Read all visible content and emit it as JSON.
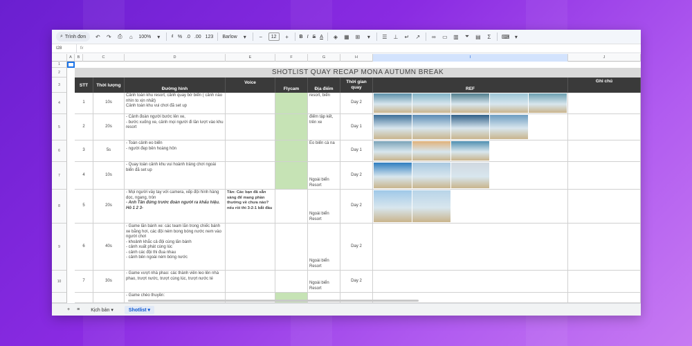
{
  "toolbar": {
    "search_label": "Trình đơn",
    "zoom": "100%",
    "currency": "₫",
    "percent": "%",
    "dec_less": ".0",
    "dec_more": ".00",
    "num_format": "123",
    "font": "Barlow",
    "font_size": "12",
    "bold": "B",
    "italic": "I",
    "strike": "S",
    "text_color": "A"
  },
  "formula": {
    "namebox": "I28",
    "fx": "fx"
  },
  "columns": [
    "A",
    "B",
    "C",
    "D",
    "E",
    "F",
    "G",
    "H",
    "I",
    "J"
  ],
  "rows": [
    "1",
    "2",
    "3",
    "4",
    "5",
    "6",
    "7",
    "8",
    "9",
    "10"
  ],
  "sheet_title": "SHOTLIST QUAY RECAP MONA AUTUMN BREAK",
  "headers": {
    "stt": "STT",
    "duration": "Thời lượng",
    "shot": "Đường hình",
    "voice": "Voice",
    "flycam": "Flycam",
    "location": "Địa điểm",
    "time": "Thời gian quay",
    "ref": "REF",
    "note": "Ghi chú"
  },
  "data_rows": [
    {
      "stt": "1",
      "duration": "10s",
      "shot": "Cảnh toàn khu resort, cảnh quay bờ biển ( cảnh nào nhìn to xịn nhất)\nCảnh toàn khu vui chơi đã set up",
      "voice": "",
      "location": "resort, biển",
      "time": "Day 2"
    },
    {
      "stt": "2",
      "duration": "20s",
      "shot": "- Cảnh đoàn người bước lên xe,\n- bước xuống xe, cảnh mọi người đi lần lượt vào khu resort",
      "voice": "",
      "location": "điểm tập kết, trên xe",
      "time": "Day 1"
    },
    {
      "stt": "3",
      "duration": "5s",
      "shot": "- Toàn cảnh eo biển\n- người đẹp bên hoàng hôn",
      "voice": "",
      "location": "Eo biển cà na",
      "time": "Day 1"
    },
    {
      "stt": "4",
      "duration": "10s",
      "shot": "- Quay toàn cảnh khu vui hoành tráng chơi ngoài biển đã set up",
      "voice": "",
      "location": "Ngoài biển Resort",
      "time": "Day 2"
    },
    {
      "stt": "5",
      "duration": "20s",
      "shot": "- Mọi người vẫy tay với camera, xếp đội hình hàng dọc, ngang, tròn",
      "shot_bold": "- Anh Tân đứng trước đoàn người ra khẩu hiệu. Hô 1 2 3-",
      "voice": "Tân: Các bạn đã sẵn sàng để mang phần thưởng về chưa nào? nếu rồi thì 3-2-1 bắt đầu",
      "location": "Ngoài biển Resort",
      "time": "Day 2"
    },
    {
      "stt": "6",
      "duration": "40s",
      "shot": "- Game lăn bánh xe: các team lăn trong chiếc bánh xe bằng hơi, các đội ném bong bóng nước nem vào người chơi\n- khoảnh khắc cả đội cùng lăn bánh\n- cảnh xuất phát cùng lúc\n- cảnh các đội thi đua nhau\n- cảnh bên ngoài ném bóng nước",
      "voice": "",
      "location": "Ngoài biển Resort",
      "time": "Day 2"
    },
    {
      "stt": "7",
      "duration": "30s",
      "shot": "- Game vượt nhà phao: các thành viên leo lên nhà phao, trượt nước, trượt cùng lúc, trượt nước té",
      "voice": "",
      "location": "Ngoài biển Resort",
      "time": "Day 2"
    },
    {
      "stt": "",
      "duration": "",
      "shot": "- Game chèo thuyền:",
      "voice": "",
      "location": "",
      "time": ""
    }
  ],
  "tabs": {
    "add": "+",
    "menu": "≡",
    "tab1": "Kịch bản",
    "tab2": "Shotlist"
  },
  "colors": {
    "header_bg": "#3a3a3a",
    "flycam_green": "#c6e3b5",
    "title_bg": "#d9d9d9",
    "accent": "#0b57d0"
  }
}
